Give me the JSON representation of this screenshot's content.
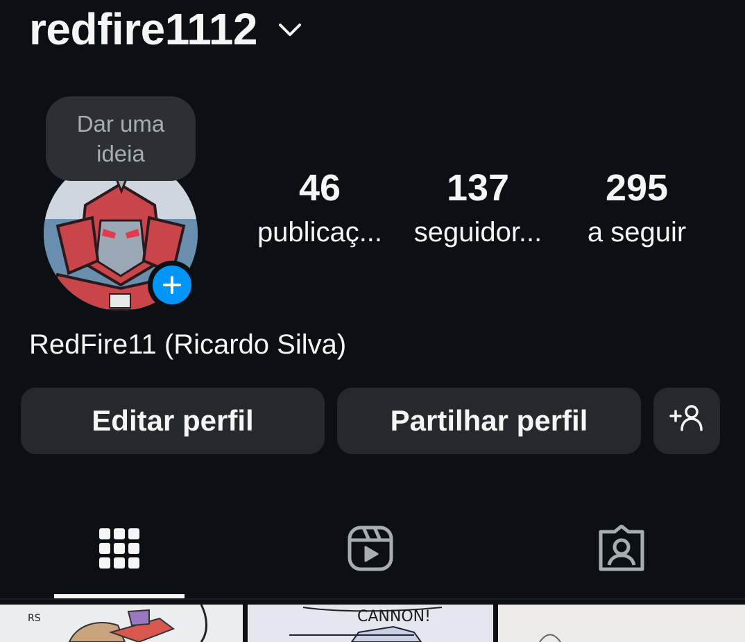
{
  "header": {
    "username": "redfire1112"
  },
  "tooltip": {
    "text": "Dar uma ideia"
  },
  "stats": [
    {
      "value": "46",
      "label": "publicaç..."
    },
    {
      "value": "137",
      "label": "seguidor..."
    },
    {
      "value": "295",
      "label": "a seguir"
    }
  ],
  "profile": {
    "full_name": "RedFire11 (Ricardo Silva)"
  },
  "buttons": {
    "edit": "Editar perfil",
    "share": "Partilhar perfil"
  },
  "tabs": [
    {
      "icon": "grid-icon",
      "active": true
    },
    {
      "icon": "reels-icon",
      "active": false
    },
    {
      "icon": "tagged-icon",
      "active": false
    }
  ],
  "posts": [
    {
      "caption": ""
    },
    {
      "caption": "CANNON!"
    },
    {
      "caption": ""
    }
  ],
  "colors": {
    "background": "#0c1014",
    "button": "#25292e",
    "accent": "#0095f6",
    "text": "#f5f5f5"
  }
}
